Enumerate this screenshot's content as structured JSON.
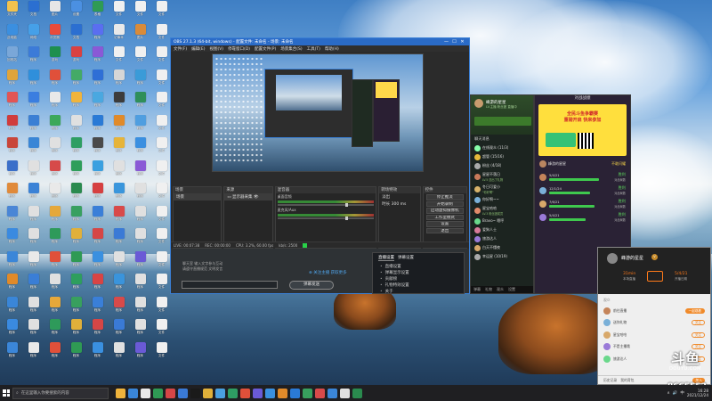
{
  "colors": {
    "accent": "#2a6bc7",
    "live_green": "#28d148",
    "douyu_orange": "#f08a2a",
    "win_green": "#5edc5e",
    "banner_yellow": "#ffdf3d"
  },
  "desktop_icons": [
    {
      "label": "文件夹",
      "color": "#f2c24e",
      "icon": "folder-icon"
    },
    {
      "label": "文档",
      "color": "#2b6fd1",
      "icon": "word-icon"
    },
    {
      "label": "图片",
      "color": "#e6e6e6",
      "icon": "image-icon"
    },
    {
      "label": "设置",
      "color": "#4b90e2",
      "icon": "gear-icon"
    },
    {
      "label": "表格",
      "color": "#2f9b54",
      "icon": "excel-icon"
    },
    {
      "label": "文件",
      "color": "#f0f0f0",
      "icon": "file-icon"
    },
    {
      "label": "文件",
      "color": "#f0f0f0",
      "icon": "file-icon"
    },
    {
      "label": "文件",
      "color": "#f0f0f0",
      "icon": "file-icon"
    },
    {
      "label": "此电脑",
      "color": "#3b8fe0",
      "icon": "computer-icon"
    },
    {
      "label": "网络",
      "color": "#46a0e8",
      "icon": "network-icon"
    },
    {
      "label": "浏览器",
      "color": "#e94b3c",
      "icon": "browser-icon"
    },
    {
      "label": "文档",
      "color": "#2b6fd1",
      "icon": "word-icon"
    },
    {
      "label": "程序",
      "color": "#5a6ef0",
      "icon": "app-icon"
    },
    {
      "label": "记事本",
      "color": "#e9e9e9",
      "icon": "notepad-icon"
    },
    {
      "label": "图片",
      "color": "#d98b3a",
      "icon": "image-icon"
    },
    {
      "label": "文件",
      "color": "#f0f0f0",
      "icon": "file-icon"
    },
    {
      "label": "回收站",
      "color": "#7aa7d8",
      "icon": "recycle-bin-icon"
    },
    {
      "label": "程序",
      "color": "#3c7bd8",
      "icon": "app-icon"
    },
    {
      "label": "游戏",
      "color": "#1e8f4e",
      "icon": "game-icon"
    },
    {
      "label": "游戏",
      "color": "#d94141",
      "icon": "game-icon"
    },
    {
      "label": "程序",
      "color": "#8a59d6",
      "icon": "app-icon"
    },
    {
      "label": "文件",
      "color": "#f0f0f0",
      "icon": "file-icon"
    },
    {
      "label": "文件",
      "color": "#f0f0f0",
      "icon": "file-icon"
    },
    {
      "label": "文件",
      "color": "#f0f0f0",
      "icon": "file-icon"
    },
    {
      "label": "程序",
      "color": "#e0a43a",
      "icon": "app-icon"
    },
    {
      "label": "程序",
      "color": "#2f8fdb",
      "icon": "app-icon"
    },
    {
      "label": "程序",
      "color": "#e0503a",
      "icon": "app-icon"
    },
    {
      "label": "程序",
      "color": "#44aa66",
      "icon": "app-icon"
    },
    {
      "label": "程序",
      "color": "#2f6fd6",
      "icon": "app-icon"
    },
    {
      "label": "程序",
      "color": "#d6d6d6",
      "icon": "app-icon"
    },
    {
      "label": "程序",
      "color": "#3a9bd8",
      "icon": "app-icon"
    },
    {
      "label": "文件",
      "color": "#f0f0f0",
      "icon": "file-icon"
    },
    {
      "label": "程序",
      "color": "#e25555",
      "icon": "app-icon"
    },
    {
      "label": "程序",
      "color": "#3a7ee0",
      "icon": "app-icon"
    },
    {
      "label": "程序",
      "color": "#e9e9e9",
      "icon": "app-icon"
    },
    {
      "label": "程序",
      "color": "#f0b43c",
      "icon": "app-icon"
    },
    {
      "label": "程序",
      "color": "#4aa8e0",
      "icon": "app-icon"
    },
    {
      "label": "程序",
      "color": "#3c3c3c",
      "icon": "app-icon"
    },
    {
      "label": "程序",
      "color": "#2f8f5a",
      "icon": "app-icon"
    },
    {
      "label": "文件",
      "color": "#f0f0f0",
      "icon": "file-icon"
    },
    {
      "label": "程序",
      "color": "#d03c3c",
      "icon": "app-icon"
    },
    {
      "label": "程序",
      "color": "#3b7fd4",
      "icon": "app-icon"
    },
    {
      "label": "程序",
      "color": "#3ca85a",
      "icon": "app-icon"
    },
    {
      "label": "程序",
      "color": "#e0e0e0",
      "icon": "app-icon"
    },
    {
      "label": "程序",
      "color": "#2a7ad6",
      "icon": "app-icon"
    },
    {
      "label": "程序",
      "color": "#e08a2a",
      "icon": "app-icon"
    },
    {
      "label": "程序",
      "color": "#4f9ee0",
      "icon": "app-icon"
    },
    {
      "label": "文件",
      "color": "#f0f0f0",
      "icon": "file-icon"
    },
    {
      "label": "程序",
      "color": "#c9463a",
      "icon": "app-icon"
    },
    {
      "label": "程序",
      "color": "#3a86d6",
      "icon": "app-icon"
    },
    {
      "label": "程序",
      "color": "#e0e0e0",
      "icon": "app-icon"
    },
    {
      "label": "程序",
      "color": "#2e9e63",
      "icon": "app-icon"
    },
    {
      "label": "程序",
      "color": "#4a4a4a",
      "icon": "app-icon"
    },
    {
      "label": "程序",
      "color": "#e6b43a",
      "icon": "app-icon"
    },
    {
      "label": "程序",
      "color": "#3a8fe0",
      "icon": "app-icon"
    },
    {
      "label": "文件",
      "color": "#f0f0f0",
      "icon": "file-icon"
    },
    {
      "label": "程序",
      "color": "#3b6fc9",
      "icon": "app-icon"
    },
    {
      "label": "程序",
      "color": "#e0e0e0",
      "icon": "app-icon"
    },
    {
      "label": "程序",
      "color": "#d64a4a",
      "icon": "app-icon"
    },
    {
      "label": "程序",
      "color": "#2f9e5a",
      "icon": "app-icon"
    },
    {
      "label": "程序",
      "color": "#3aa0e0",
      "icon": "app-icon"
    },
    {
      "label": "程序",
      "color": "#e0e0e0",
      "icon": "app-icon"
    },
    {
      "label": "程序",
      "color": "#8a5ad6",
      "icon": "app-icon"
    },
    {
      "label": "文件",
      "color": "#f0f0f0",
      "icon": "file-icon"
    },
    {
      "label": "程序",
      "color": "#e08a3a",
      "icon": "app-icon"
    },
    {
      "label": "程序",
      "color": "#3b82d6",
      "icon": "app-icon"
    },
    {
      "label": "程序",
      "color": "#e9e9e9",
      "icon": "app-icon"
    },
    {
      "label": "程序",
      "color": "#2a8a4e",
      "icon": "app-icon"
    },
    {
      "label": "程序",
      "color": "#d64040",
      "icon": "app-icon"
    },
    {
      "label": "程序",
      "color": "#3a96dc",
      "icon": "app-icon"
    },
    {
      "label": "程序",
      "color": "#e0e0e0",
      "icon": "app-icon"
    },
    {
      "label": "文件",
      "color": "#f0f0f0",
      "icon": "file-icon"
    },
    {
      "label": "程序",
      "color": "#4a86d6",
      "icon": "app-icon"
    },
    {
      "label": "程序",
      "color": "#e0e0e0",
      "icon": "app-icon"
    },
    {
      "label": "程序",
      "color": "#e6a83a",
      "icon": "app-icon"
    },
    {
      "label": "程序",
      "color": "#38a060",
      "icon": "app-icon"
    },
    {
      "label": "程序",
      "color": "#3a7fd8",
      "icon": "app-icon"
    },
    {
      "label": "程序",
      "color": "#d84a4a",
      "icon": "app-icon"
    },
    {
      "label": "程序",
      "color": "#e0e0e0",
      "icon": "app-icon"
    },
    {
      "label": "文件",
      "color": "#f0f0f0",
      "icon": "file-icon"
    },
    {
      "label": "程序",
      "color": "#3a8ae0",
      "icon": "app-icon"
    },
    {
      "label": "程序",
      "color": "#e0e0e0",
      "icon": "app-icon"
    },
    {
      "label": "程序",
      "color": "#2e9a5a",
      "icon": "app-icon"
    },
    {
      "label": "程序",
      "color": "#e0b03a",
      "icon": "app-icon"
    },
    {
      "label": "程序",
      "color": "#d64646",
      "icon": "app-icon"
    },
    {
      "label": "程序",
      "color": "#3a7ad6",
      "icon": "app-icon"
    },
    {
      "label": "程序",
      "color": "#e0e0e0",
      "icon": "app-icon"
    },
    {
      "label": "文件",
      "color": "#f0f0f0",
      "icon": "file-icon"
    },
    {
      "label": "程序",
      "color": "#3b86d8",
      "icon": "app-icon"
    },
    {
      "label": "程序",
      "color": "#e9e9e9",
      "icon": "app-icon"
    },
    {
      "label": "程序",
      "color": "#e0503a",
      "icon": "app-icon"
    },
    {
      "label": "程序",
      "color": "#2f9a54",
      "icon": "app-icon"
    },
    {
      "label": "程序",
      "color": "#3a90e0",
      "icon": "app-icon"
    },
    {
      "label": "程序",
      "color": "#e0e0e0",
      "icon": "app-icon"
    },
    {
      "label": "程序",
      "color": "#6a5ad6",
      "icon": "app-icon"
    },
    {
      "label": "文件",
      "color": "#f0f0f0",
      "icon": "file-icon"
    },
    {
      "label": "程序",
      "color": "#e08a2a",
      "icon": "app-icon"
    },
    {
      "label": "程序",
      "color": "#3a7ed6",
      "icon": "app-icon"
    },
    {
      "label": "程序",
      "color": "#e0e0e0",
      "icon": "app-icon"
    },
    {
      "label": "程序",
      "color": "#2e9e5e",
      "icon": "app-icon"
    },
    {
      "label": "程序",
      "color": "#d84444",
      "icon": "app-icon"
    },
    {
      "label": "程序",
      "color": "#3a94dc",
      "icon": "app-icon"
    },
    {
      "label": "程序",
      "color": "#e0e0e0",
      "icon": "app-icon"
    },
    {
      "label": "文件",
      "color": "#f0f0f0",
      "icon": "file-icon"
    },
    {
      "label": "程序",
      "color": "#3a86d8",
      "icon": "app-icon"
    },
    {
      "label": "程序",
      "color": "#e0e0e0",
      "icon": "app-icon"
    },
    {
      "label": "程序",
      "color": "#e6a83a",
      "icon": "app-icon"
    },
    {
      "label": "程序",
      "color": "#38a05e",
      "icon": "app-icon"
    },
    {
      "label": "程序",
      "color": "#3a7fd8",
      "icon": "app-icon"
    },
    {
      "label": "程序",
      "color": "#d84a4a",
      "icon": "app-icon"
    },
    {
      "label": "程序",
      "color": "#e0e0e0",
      "icon": "app-icon"
    },
    {
      "label": "文件",
      "color": "#f0f0f0",
      "icon": "file-icon"
    },
    {
      "label": "程序",
      "color": "#3a8ae0",
      "icon": "app-icon"
    },
    {
      "label": "程序",
      "color": "#e0e0e0",
      "icon": "app-icon"
    },
    {
      "label": "程序",
      "color": "#2e9a5a",
      "icon": "app-icon"
    },
    {
      "label": "程序",
      "color": "#e0b03a",
      "icon": "app-icon"
    },
    {
      "label": "程序",
      "color": "#d64646",
      "icon": "app-icon"
    },
    {
      "label": "程序",
      "color": "#3a7ad6",
      "icon": "app-icon"
    },
    {
      "label": "程序",
      "color": "#e0e0e0",
      "icon": "app-icon"
    },
    {
      "label": "文件",
      "color": "#f0f0f0",
      "icon": "file-icon"
    },
    {
      "label": "程序",
      "color": "#3b86d8",
      "icon": "app-icon"
    },
    {
      "label": "程序",
      "color": "#e9e9e9",
      "icon": "app-icon"
    },
    {
      "label": "程序",
      "color": "#e0503a",
      "icon": "app-icon"
    },
    {
      "label": "程序",
      "color": "#2f9a54",
      "icon": "app-icon"
    },
    {
      "label": "程序",
      "color": "#3a90e0",
      "icon": "app-icon"
    },
    {
      "label": "程序",
      "color": "#e0e0e0",
      "icon": "app-icon"
    },
    {
      "label": "程序",
      "color": "#6a5ad6",
      "icon": "app-icon"
    },
    {
      "label": "文件",
      "color": "#f0f0f0",
      "icon": "file-icon"
    }
  ],
  "obs": {
    "title": "OBS 27.1.3 (64-bit, windows) - 配置文件: 未命名 - 场景: 未命名",
    "menu": [
      "文件(F)",
      "编辑(E)",
      "视图(V)",
      "停靠窗口(D)",
      "配置文件(P)",
      "场景集合(S)",
      "工具(T)",
      "帮助(H)"
    ],
    "panels": {
      "scenes": {
        "title": "场景",
        "items": [
          "场景"
        ]
      },
      "sources": {
        "title": "来源",
        "items": [
          "显示器采集"
        ]
      },
      "mixer": {
        "title": "混音器",
        "tracks": [
          {
            "name": "桌面音频",
            "db": "0.0 dB"
          },
          {
            "name": "麦克风/Aux",
            "db": "0.0 dB"
          }
        ]
      },
      "transitions": {
        "title": "转场特效",
        "items": [
          "淡出",
          "时长 300 ms"
        ]
      },
      "controls": {
        "title": "控件",
        "buttons": [
          "停止推流",
          "开始录制",
          "启动虚拟摄像机",
          "工作室模式",
          "设置",
          "退出"
        ]
      }
    },
    "panel_footer": "+ − ∧ ∨",
    "status": {
      "left": "LIVE: 00:07:38",
      "rec": "REC: 00:00:00",
      "cpu": "CPU: 3.2%, 60.00 fps",
      "kbps": "kb/s: 2500"
    },
    "bottom": {
      "hint": "聊天室 输入文字参与互动\n请遵守直播规范 文明发言",
      "subscribe": "⊕ 关注主播 获取更多",
      "button": "弹幕发送"
    }
  },
  "dropdown": {
    "tabs": [
      "直播设置",
      "弹幕设置"
    ],
    "items": [
      "直播设置",
      "弹幕显示设置",
      "贡献榜",
      "礼物特效设置",
      "关于"
    ]
  },
  "chat": {
    "anchor": "峰游的星星",
    "anchor_sub": "LV.主播 粉丝团 直播中",
    "section": "聊天消息",
    "users": [
      {
        "name": "在线观众 (11/3)",
        "sub": "",
        "color": "#8fa"
      },
      {
        "name": "超管 (15/16)",
        "sub": "",
        "color": "#e6b93b"
      },
      {
        "name": "粉丝 (4/18)",
        "sub": "",
        "color": "#aaa"
      },
      {
        "name": "星星不落日",
        "sub": "LV.5 送出了礼物",
        "color": "#c97a5a"
      },
      {
        "name": "冬日可爱小",
        "sub": "\"你好啊\"",
        "color": "#d8b36a"
      },
      {
        "name": "你好啊~~",
        "sub": "",
        "color": "#7ab0d8"
      },
      {
        "name": "星宝哈哈",
        "sub": "LV.3 粉丝团成员",
        "color": "#e28b6a"
      },
      {
        "name": "Bravo~ 嗯哼",
        "sub": "",
        "color": "#6ad88b"
      },
      {
        "name": "爱狗人士",
        "sub": "",
        "color": "#d87a9a"
      },
      {
        "name": "旅游达人",
        "sub": "",
        "color": "#9a7ad8"
      },
      {
        "name": "白天不懂夜",
        "sub": "",
        "color": "#d8a86a"
      },
      {
        "name": "幸运星 (10/19)",
        "sub": "",
        "color": "#aaa"
      }
    ],
    "footer": [
      "弹幕",
      "礼物",
      "观众",
      "设置"
    ]
  },
  "game": {
    "title": "对战战绩",
    "banner": "全民斗鱼争霸赛\n重磅开启 快来参加",
    "user": {
      "name": "峰游的星星",
      "status": "不敢闪耀"
    },
    "rows": [
      {
        "date": "5/4/21",
        "result": "胜利",
        "sub": "对战局数",
        "bar": 0.8,
        "color": "#c4845a",
        "win": true
      },
      {
        "date": "12/1/24",
        "result": "胜利",
        "sub": "对战局数",
        "bar": 0.65,
        "color": "#7ab0d8",
        "win": true
      },
      {
        "date": "7/6/21",
        "result": "胜利",
        "sub": "对战局数",
        "bar": 0.72,
        "color": "#d8a86a",
        "win": true
      },
      {
        "date": "5/4/21",
        "result": "胜利",
        "sub": "对战局数",
        "bar": 0.58,
        "color": "#9a7ad8",
        "win": true
      }
    ]
  },
  "profile": {
    "name": "峰游的星星",
    "badge": "V",
    "time": "31min",
    "time_sub": "本场直播",
    "date": "5/4/21",
    "date_sub": "开播日期",
    "section": "观众",
    "rows": [
      {
        "name": "前往直播",
        "btn": "一起观看",
        "primary": true,
        "color": "#c4845a"
      },
      {
        "name": "送你礼物",
        "btn": "关注",
        "primary": false,
        "color": "#7ab0d8"
      },
      {
        "name": "星宝哈哈",
        "btn": "关注",
        "primary": false,
        "color": "#d8a86a"
      },
      {
        "name": "不是主播哦",
        "btn": "关注",
        "primary": false,
        "color": "#9a7ad8"
      },
      {
        "name": "旅游达人",
        "btn": "关注",
        "primary": false,
        "color": "#6ad88b"
      }
    ],
    "footer": [
      "历史记录",
      "我的背包"
    ],
    "join": "加入"
  },
  "watermark": {
    "logo": "斗鱼",
    "sub": "DOUYU.COM",
    "room": "8665553"
  },
  "taskbar": {
    "search_placeholder": "在这里输入你要搜索的内容",
    "apps": [
      "#f0b43c",
      "#3a86d8",
      "#e9e9e9",
      "#2f9a54",
      "#d64646",
      "#3a7ad6",
      "#1a1a1a",
      "#e0b03a",
      "#4aa0e0",
      "#2e9e63",
      "#e0503a",
      "#6a5ad6",
      "#3a90e0",
      "#e08a2a",
      "#2a7ad6",
      "#38a05e",
      "#d84a4a",
      "#3b86d8",
      "#e0e0e0",
      "#2a8a4e"
    ],
    "tray": [
      "∧",
      "🔊",
      "中"
    ],
    "time": "16:28",
    "date": "2021/12/24"
  }
}
